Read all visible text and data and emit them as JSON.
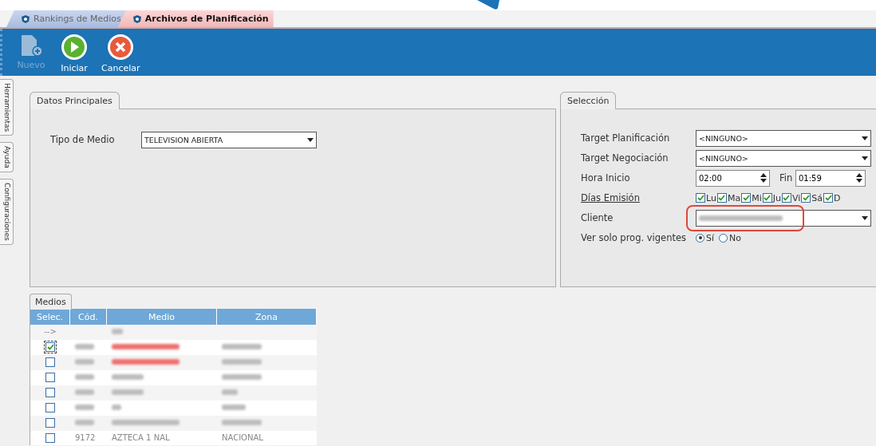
{
  "doc_tabs": [
    {
      "label": "Rankings de Medios",
      "selected": false
    },
    {
      "label": "Archivos de Planificación",
      "selected": true
    }
  ],
  "toolbar": [
    {
      "label": "Nuevo",
      "kind": "new",
      "disabled": true
    },
    {
      "label": "Iniciar",
      "kind": "start",
      "disabled": false
    },
    {
      "label": "Cancelar",
      "kind": "cancel",
      "disabled": false
    }
  ],
  "side_tabs": [
    "Herramientas",
    "Ayuda",
    "Configuraciones"
  ],
  "datos_principales": {
    "title": "Datos Principales",
    "tipo_de_medio": {
      "label": "Tipo de Medio",
      "value": "TELEVISION ABIERTA"
    }
  },
  "seleccion": {
    "title": "Selección",
    "target_planificacion": {
      "label": "Target Planificación",
      "value": "<NINGUNO>"
    },
    "target_negociacion": {
      "label": "Target Negociación",
      "value": "<NINGUNO>"
    },
    "hora_inicio": {
      "label": "Hora Inicio",
      "value": "02:00"
    },
    "fin": {
      "label": "Fin",
      "value": "01:59"
    },
    "dias_emision": {
      "label": "Días Emisión",
      "days": [
        {
          "label": "Lu",
          "checked": true
        },
        {
          "label": "Ma",
          "checked": true
        },
        {
          "label": "Mi",
          "checked": true
        },
        {
          "label": "Ju",
          "checked": true
        },
        {
          "label": "Vi",
          "checked": true
        },
        {
          "label": "Sá",
          "checked": true
        },
        {
          "label": "D",
          "checked": true
        }
      ]
    },
    "cliente": {
      "label": "Cliente",
      "highlighted": true
    },
    "ver_solo_vigentes": {
      "label": "Ver solo prog. vigentes",
      "options": [
        {
          "label": "Sí",
          "selected": true
        },
        {
          "label": "No",
          "selected": false
        }
      ]
    }
  },
  "medios": {
    "title": "Medios",
    "columns": [
      "Selec.",
      "Cód.",
      "Medio",
      "Zona"
    ],
    "filter_row": {
      "marker": "-->"
    },
    "rows": [
      {
        "checked": true,
        "alert": true
      },
      {
        "checked": false,
        "alert": true
      },
      {
        "checked": false,
        "alert": false
      },
      {
        "checked": false,
        "alert": false
      },
      {
        "checked": false,
        "alert": false
      },
      {
        "checked": false,
        "alert": false
      },
      {
        "checked": false,
        "alert": false,
        "cod": "9172",
        "medio": "AZTECA 1 NAL",
        "zona": "NACIONAL"
      }
    ]
  }
}
